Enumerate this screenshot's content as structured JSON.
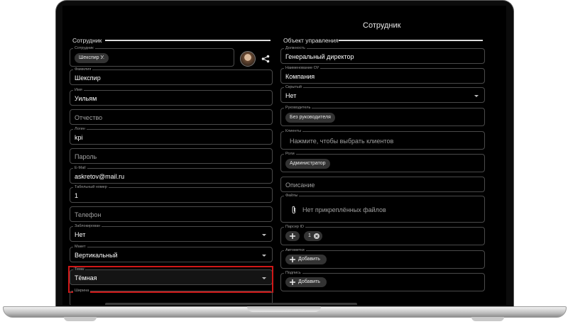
{
  "header": {
    "title": "Сотрудник"
  },
  "left": {
    "section_title": "Сотрудник",
    "employee": {
      "label": "Сотрудник",
      "chip": "Шекспир У."
    },
    "surname": {
      "label": "Фамилия",
      "value": "Шекспир"
    },
    "name": {
      "label": "Имя",
      "value": "Уильям"
    },
    "patronymic": {
      "placeholder": "Отчество"
    },
    "login": {
      "label": "Логин",
      "value": "kpi"
    },
    "password": {
      "placeholder": "Пароль"
    },
    "email": {
      "label": "E-Mail",
      "value": "askretov@mail.ru"
    },
    "tab_number": {
      "label": "Табельный номер",
      "value": "1"
    },
    "phone": {
      "placeholder": "Телефон"
    },
    "blocked": {
      "label": "Заблокирован",
      "value": "Нет"
    },
    "layout": {
      "label": "Макет",
      "value": "Вертикальный"
    },
    "theme": {
      "label": "Тема",
      "value": "Тёмная"
    },
    "cut_label": "Ширина"
  },
  "right": {
    "section_title": "Объект управления",
    "position": {
      "label": "Должность",
      "value": "Генеральный директор"
    },
    "ou_name": {
      "label": "Наименование ОУ",
      "value": "Компания"
    },
    "hidden": {
      "label": "Скрытый",
      "value": "Нет"
    },
    "manager": {
      "label": "Руководитель",
      "chip": "Без руководителя"
    },
    "clients": {
      "label": "Клиенты",
      "placeholder": "Нажмите, чтобы выбрать клиентов"
    },
    "roles": {
      "label": "Роли",
      "chip": "Администратор"
    },
    "description": {
      "placeholder": "Описание"
    },
    "files": {
      "label": "Файлы",
      "text": "Нет прикреплённых файлов"
    },
    "parser": {
      "label": "Парсер ID",
      "chip": "1"
    },
    "tags": {
      "label": "Автометки",
      "button": "Добавить"
    },
    "signature": {
      "label": "Подпись",
      "button": "Добавить"
    }
  },
  "icons": {
    "share": "share-icon",
    "dropdown": "chevron-down-icon",
    "attach": "paperclip-icon",
    "add": "plus-icon",
    "remove": "close-circle-icon"
  },
  "colors": {
    "highlight": "#d01818",
    "background": "#000000"
  }
}
